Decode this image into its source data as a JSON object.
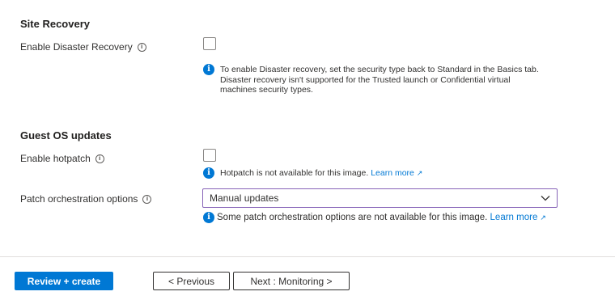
{
  "site_recovery": {
    "title": "Site Recovery",
    "enable_dr_label": "Enable Disaster Recovery",
    "enable_dr_checked": false,
    "note_line1": "To enable Disaster recovery, set the security type back to Standard in the Basics tab.",
    "note_line2": "Disaster recovery isn't supported for the Trusted launch or Confidential virtual",
    "note_line3": "machines security types."
  },
  "guest_os": {
    "title": "Guest OS updates",
    "hotpatch_label": "Enable hotpatch",
    "hotpatch_checked": false,
    "hotpatch_note": "Hotpatch is not available for this image.",
    "hotpatch_link": "Learn more",
    "patch_label": "Patch orchestration options",
    "patch_value": "Manual updates",
    "patch_note": "Some patch orchestration options are not available for this image.",
    "patch_link": "Learn more"
  },
  "icons": {
    "info_outline": "i",
    "info_filled": "i",
    "external": "↗"
  },
  "footer": {
    "review_label": "Review + create",
    "previous_label": "< Previous",
    "next_label": "Next : Monitoring >"
  },
  "colors": {
    "accent": "#0078d4",
    "select_border": "#8764b8"
  }
}
